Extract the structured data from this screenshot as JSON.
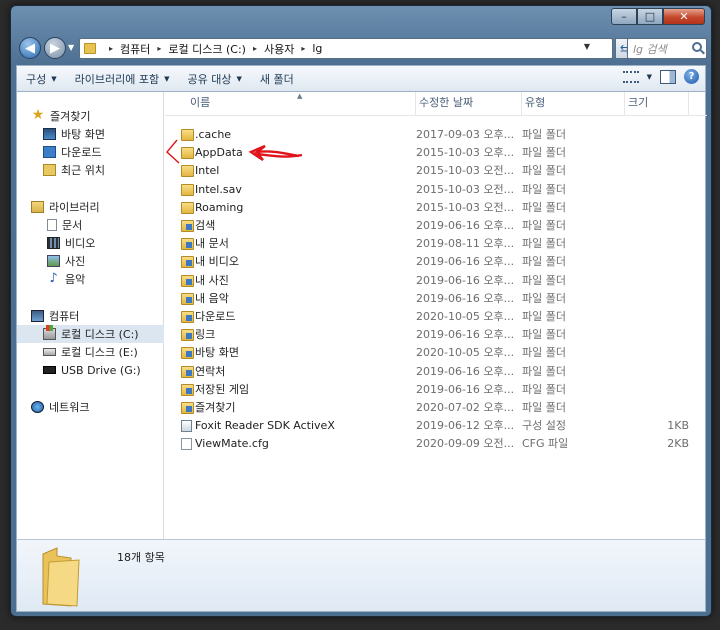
{
  "window": {
    "minimize_glyph": "–",
    "maximize_glyph": "□",
    "close_glyph": "✕"
  },
  "address_bar": {
    "breadcrumbs": [
      "컴퓨터",
      "로컬 디스크 (C:)",
      "사용자",
      "lg"
    ],
    "separator": "▸",
    "search_placeholder": "lg 검색"
  },
  "toolbar": {
    "organize": "구성",
    "include_library": "라이브러리에 포함",
    "share": "공유 대상",
    "new_folder": "새 폴더",
    "help": "?"
  },
  "nav_pane": {
    "favorites_header": "즐겨찾기",
    "favorites": [
      "바탕 화면",
      "다운로드",
      "최근 위치"
    ],
    "libraries_header": "라이브러리",
    "libraries": [
      "문서",
      "비디오",
      "사진",
      "음악"
    ],
    "computer_header": "컴퓨터",
    "drives": [
      "로컬 디스크 (C:)",
      "로컬 디스크 (E:)",
      "USB Drive (G:)"
    ],
    "network": "네트워크"
  },
  "columns": {
    "name": "이름",
    "date": "수정한 날짜",
    "type": "유형",
    "size": "크기"
  },
  "files": [
    {
      "name": ".cache",
      "date": "2017-09-03 오후...",
      "type": "파일 폴더",
      "size": "",
      "icon": "folder"
    },
    {
      "name": "AppData",
      "date": "2015-10-03 오후...",
      "type": "파일 폴더",
      "size": "",
      "icon": "folder"
    },
    {
      "name": "Intel",
      "date": "2015-10-03 오전...",
      "type": "파일 폴더",
      "size": "",
      "icon": "folder"
    },
    {
      "name": "Intel.sav",
      "date": "2015-10-03 오전...",
      "type": "파일 폴더",
      "size": "",
      "icon": "folder"
    },
    {
      "name": "Roaming",
      "date": "2015-10-03 오전...",
      "type": "파일 폴더",
      "size": "",
      "icon": "folder"
    },
    {
      "name": "검색",
      "date": "2019-06-16 오후...",
      "type": "파일 폴더",
      "size": "",
      "icon": "folder-special"
    },
    {
      "name": "내 문서",
      "date": "2019-08-11 오후...",
      "type": "파일 폴더",
      "size": "",
      "icon": "folder-special"
    },
    {
      "name": "내 비디오",
      "date": "2019-06-16 오후...",
      "type": "파일 폴더",
      "size": "",
      "icon": "folder-special"
    },
    {
      "name": "내 사진",
      "date": "2019-06-16 오후...",
      "type": "파일 폴더",
      "size": "",
      "icon": "folder-special"
    },
    {
      "name": "내 음악",
      "date": "2019-06-16 오후...",
      "type": "파일 폴더",
      "size": "",
      "icon": "folder-special"
    },
    {
      "name": "다운로드",
      "date": "2020-10-05 오후...",
      "type": "파일 폴더",
      "size": "",
      "icon": "folder-special"
    },
    {
      "name": "링크",
      "date": "2019-06-16 오후...",
      "type": "파일 폴더",
      "size": "",
      "icon": "folder-special"
    },
    {
      "name": "바탕 화면",
      "date": "2020-10-05 오후...",
      "type": "파일 폴더",
      "size": "",
      "icon": "folder-special"
    },
    {
      "name": "연락처",
      "date": "2019-06-16 오후...",
      "type": "파일 폴더",
      "size": "",
      "icon": "folder-special"
    },
    {
      "name": "저장된 게임",
      "date": "2019-06-16 오후...",
      "type": "파일 폴더",
      "size": "",
      "icon": "folder-special"
    },
    {
      "name": "즐겨찾기",
      "date": "2020-07-02 오후...",
      "type": "파일 폴더",
      "size": "",
      "icon": "folder-special"
    },
    {
      "name": "Foxit Reader SDK ActiveX",
      "date": "2019-06-12 오후...",
      "type": "구성 설정",
      "size": "1KB",
      "icon": "setting"
    },
    {
      "name": "ViewMate.cfg",
      "date": "2020-09-09 오전...",
      "type": "CFG 파일",
      "size": "2KB",
      "icon": "file"
    }
  ],
  "details": {
    "item_count": "18개 항목"
  },
  "colors": {
    "annotation": "#e0141a",
    "window_frame": "#5b7d9f",
    "selection": "#dce6f1"
  }
}
